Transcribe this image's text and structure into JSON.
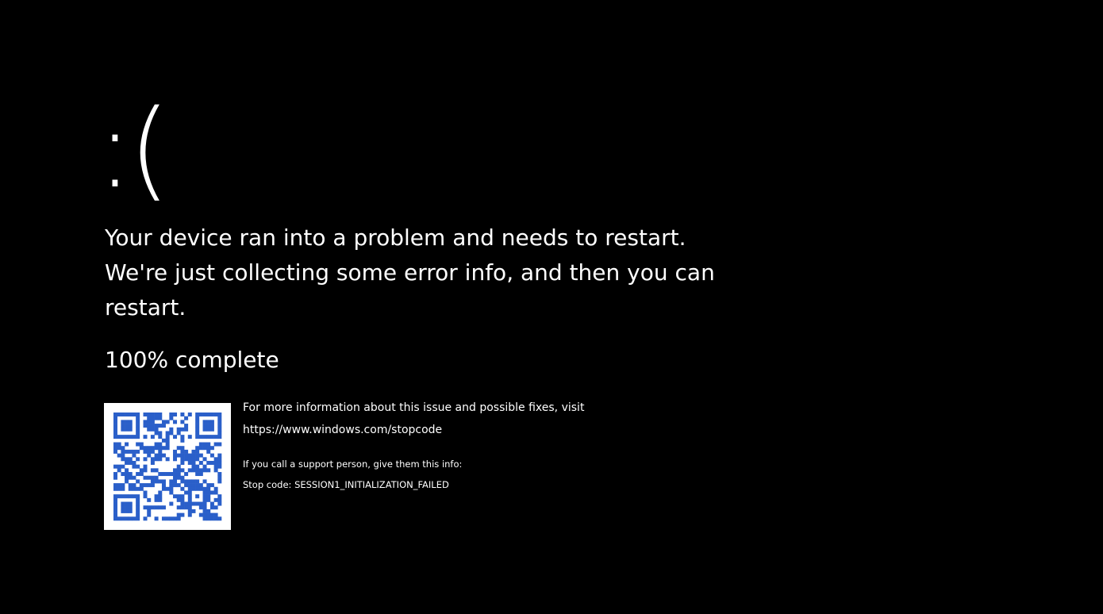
{
  "colors": {
    "background": "#000000",
    "text": "#ffffff",
    "qr_fill": "#2a5fc9",
    "qr_background": "#ffffff"
  },
  "screen": {
    "emoticon": ":(",
    "message_lines": [
      "Your device ran into a problem and needs to restart.",
      "We're just collecting some error info, and then you can",
      "restart."
    ],
    "progress_text": "100% complete",
    "progress_percent": 100,
    "qr_icon": "qr-code-icon",
    "more_info_text": "For more information about this issue and possible fixes, visit",
    "url": "https://www.windows.com/stopcode",
    "support_text": "If you call a support person, give them this info:",
    "stop_code_text": "Stop code: SESSION1_INITIALIZATION_FAILED"
  }
}
